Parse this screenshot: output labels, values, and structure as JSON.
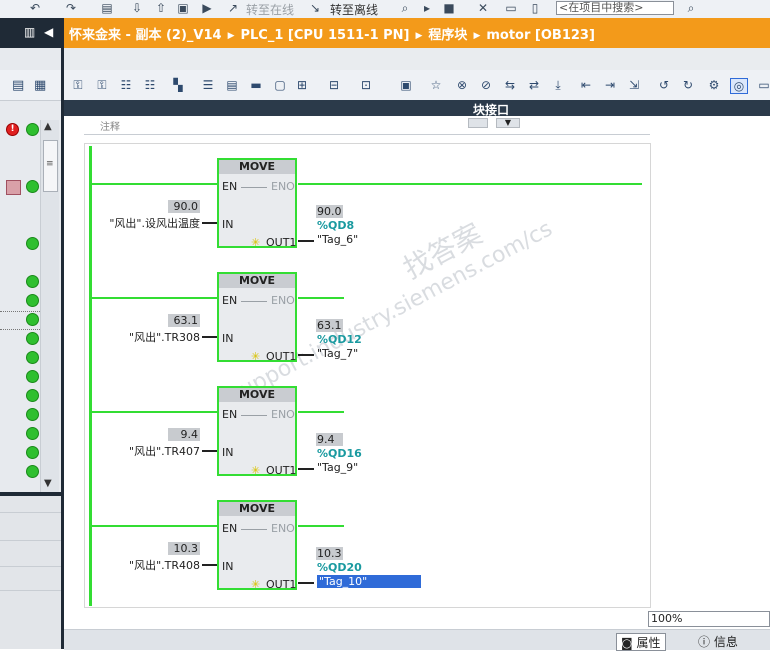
{
  "top_toolbar": {
    "go_online": "转至在线",
    "go_offline": "转至离线",
    "search_placeholder": "<在项目中搜索>"
  },
  "breadcrumb": {
    "project": "怀来金来 - 副本 (2)_V14",
    "plc": "PLC_1 [CPU 1511-1 PN]",
    "folder": "程序块",
    "block": "motor [OB123]"
  },
  "editor": {
    "interface_label": "块接口",
    "interface_row_text": "注释"
  },
  "colors": {
    "title_bar": "#f39a1a",
    "wire": "#33dd33",
    "address": "#1a9aa0",
    "selection": "#2f6bd8"
  },
  "networks": [
    {
      "block": "MOVE",
      "en": "EN",
      "eno": "ENO",
      "in": "IN",
      "out1": "OUT1",
      "in_value": "90.0",
      "in_tag": "\"风出\".设风出温度",
      "out_value": "90.0",
      "out_address": "%QD8",
      "out_tag": "\"Tag_6\""
    },
    {
      "block": "MOVE",
      "en": "EN",
      "eno": "ENO",
      "in": "IN",
      "out1": "OUT1",
      "in_value": "63.1",
      "in_tag": "\"风出\".TR308",
      "out_value": "63.1",
      "out_address": "%QD12",
      "out_tag": "\"Tag_7\""
    },
    {
      "block": "MOVE",
      "en": "EN",
      "eno": "ENO",
      "in": "IN",
      "out1": "OUT1",
      "in_value": "9.4",
      "in_tag": "\"风出\".TR407",
      "out_value": "9.4",
      "out_address": "%QD16",
      "out_tag": "\"Tag_9\""
    },
    {
      "block": "MOVE",
      "en": "EN",
      "eno": "ENO",
      "in": "IN",
      "out1": "OUT1",
      "in_value": "10.3",
      "in_tag": "\"风出\".TR408",
      "out_value": "10.3",
      "out_address": "%QD20",
      "out_tag": "\"Tag_10\""
    }
  ],
  "watermark": {
    "line1": "support.industry.siemens.com/cs",
    "line2": "找答案"
  },
  "status": {
    "zoom": "100%"
  },
  "bottom_tabs": {
    "properties": "属性",
    "info": "信息"
  }
}
